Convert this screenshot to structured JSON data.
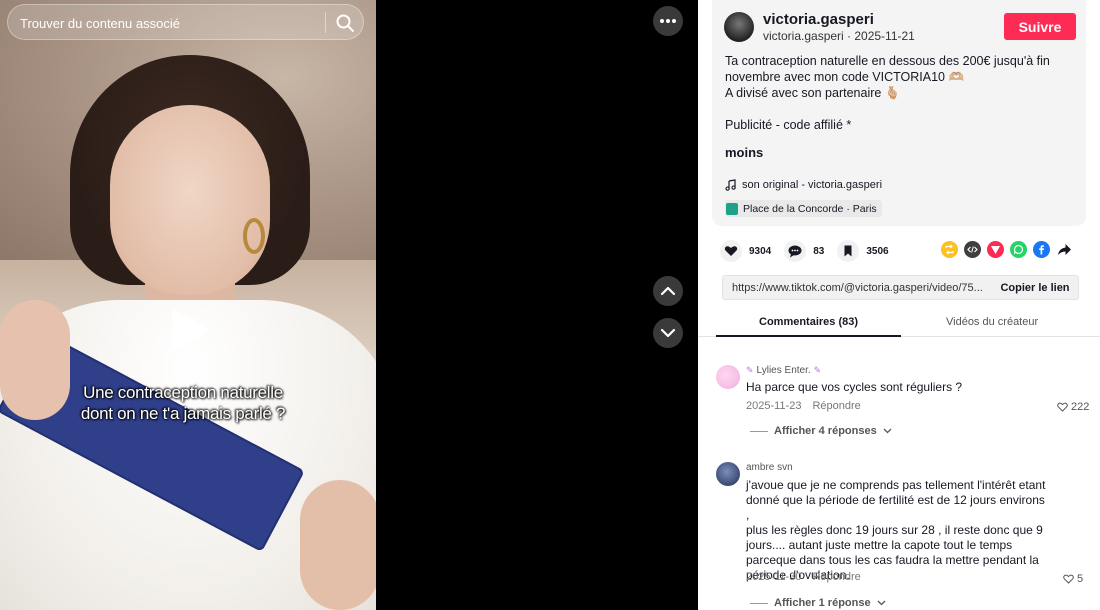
{
  "search": {
    "placeholder": "Trouver du contenu associé"
  },
  "video": {
    "caption_line1": "Une contraception naturelle",
    "caption_line2": "dont on ne t'a jamais parlé ?"
  },
  "author": {
    "name": "victoria.gasperi",
    "meta": "victoria.gasperi · 2025-11-21",
    "follow_label": "Suivre"
  },
  "description": {
    "line1": "Ta contraception naturelle en dessous des 200€ jusqu'à fin",
    "line2": "novembre avec mon code VICTORIA10 🫶🏼",
    "line3": "A divisé avec son partenaire 🫰🏼",
    "line4": "Publicité - code affilié *",
    "less_label": "moins"
  },
  "music": {
    "label": "son original - victoria.gasperi"
  },
  "location": {
    "label": "Place de la Concorde · Paris"
  },
  "stats": {
    "likes": "9304",
    "comments": "83",
    "saves": "3506"
  },
  "link": {
    "url": "https://www.tiktok.com/@victoria.gasperi/video/75...",
    "copy_label": "Copier le lien"
  },
  "tabs": {
    "comments": "Commentaires (83)",
    "videos": "Vidéos du créateur"
  },
  "comments": [
    {
      "user": "Lylies Enter.",
      "text": "Ha parce que vos cycles sont réguliers ?",
      "date": "2025-11-23",
      "reply_label": "Répondre",
      "likes": "222",
      "more_replies": "Afficher 4 réponses"
    },
    {
      "user": "ambre svn",
      "text_lines": [
        "j'avoue que je ne comprends pas tellement l'intérêt etant",
        "donné que la période de fertilité est de 12 jours environs ,",
        "plus les règles donc 19 jours sur 28 , il reste donc que 9",
        "jours.... autant juste mettre la capote tout le temps",
        "parceque dans tous les cas faudra la mettre pendant la",
        "période d'ovulation."
      ],
      "date": "2025-11-30",
      "reply_label": "Répondre",
      "likes": "5",
      "more_replies": "Afficher 1 réponse"
    }
  ],
  "colors": {
    "accent": "#fe2c55",
    "text": "#161823",
    "card_bg": "#f4f4f4",
    "location_icon": "#1ea089"
  },
  "icons": [
    "search-icon",
    "play-icon",
    "more-icon",
    "chevron-up-icon",
    "chevron-down-icon",
    "heart-icon",
    "comment-icon",
    "bookmark-icon",
    "music-note-icon",
    "location-icon",
    "repost-icon",
    "embed-icon",
    "send-icon",
    "whatsapp-icon",
    "facebook-icon",
    "share-arrow-icon"
  ]
}
